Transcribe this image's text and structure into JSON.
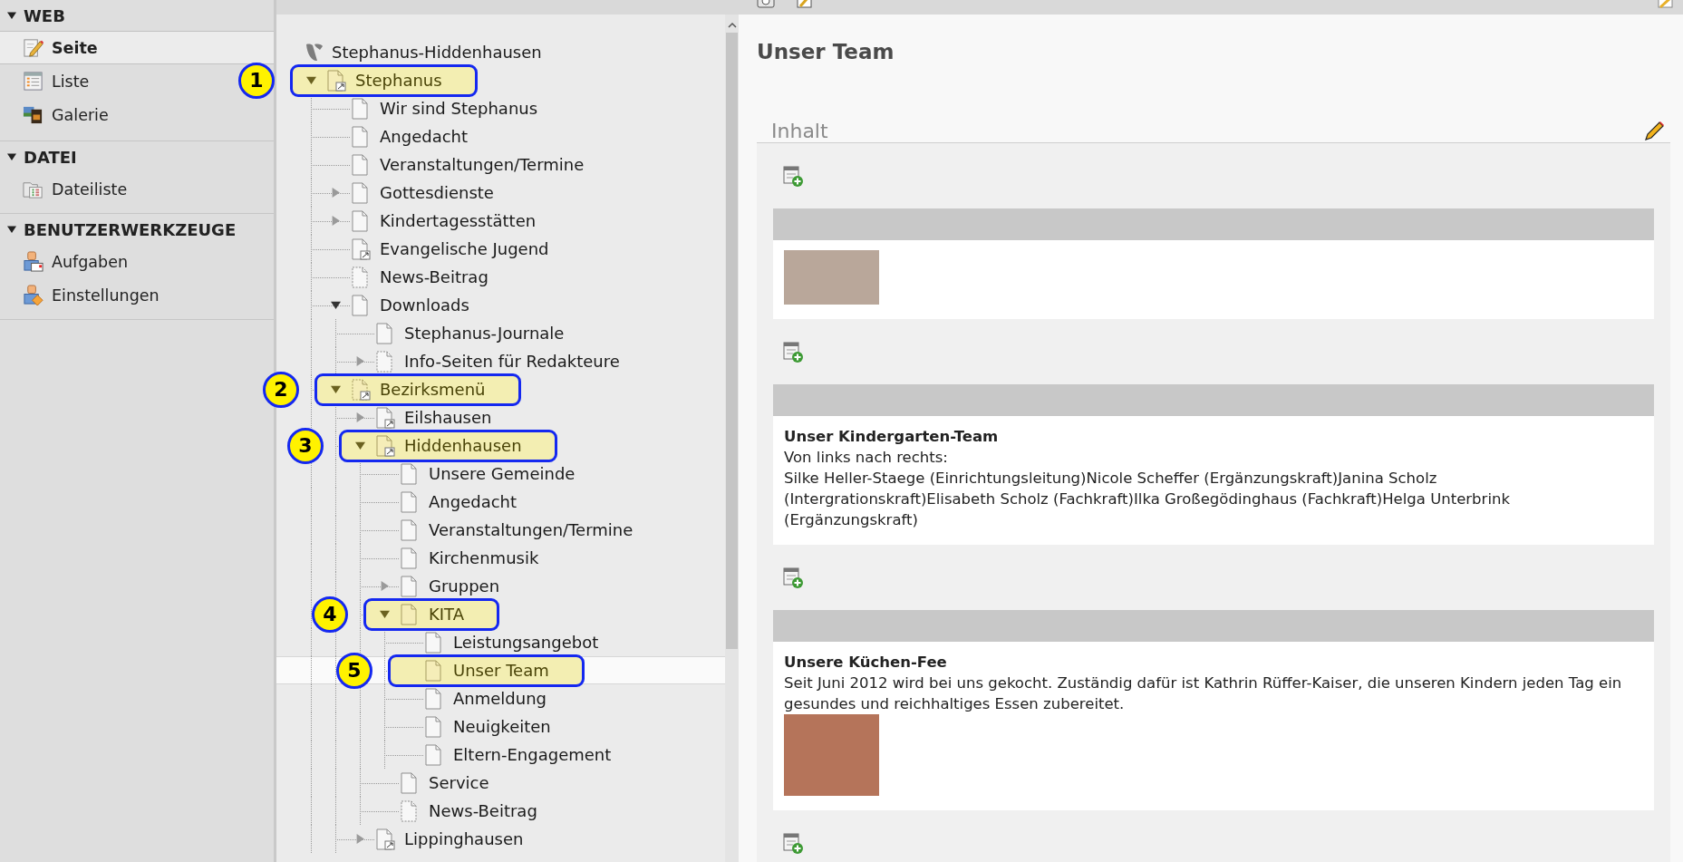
{
  "module_menu": {
    "sections": [
      {
        "title": "WEB",
        "expanded": true,
        "items": [
          {
            "label": "Seite",
            "kind": "page-edit",
            "selected": true
          },
          {
            "label": "Liste",
            "kind": "list",
            "selected": false
          },
          {
            "label": "Galerie",
            "kind": "gallery",
            "selected": false
          }
        ]
      },
      {
        "title": "DATEI",
        "expanded": true,
        "items": [
          {
            "label": "Dateiliste",
            "kind": "filelist",
            "selected": false
          }
        ]
      },
      {
        "title": "BENUTZERWERKZEUGE",
        "expanded": true,
        "items": [
          {
            "label": "Aufgaben",
            "kind": "tasks",
            "selected": false
          },
          {
            "label": "Einstellungen",
            "kind": "settings",
            "selected": false
          }
        ]
      }
    ]
  },
  "page_tree": {
    "root": {
      "label": "Stephanus-Hiddenhausen",
      "kind": "site-root",
      "selected": false,
      "children": [
        {
          "label": "Stephanus",
          "kind": "shortcut",
          "expanded": true,
          "callout": "1",
          "selected": false,
          "children": [
            {
              "label": "Wir sind Stephanus",
              "kind": "page",
              "selected": false
            },
            {
              "label": "Angedacht",
              "kind": "page",
              "selected": false
            },
            {
              "label": "Veranstaltungen/Termine",
              "kind": "page",
              "selected": false
            },
            {
              "label": "Gottesdienste",
              "kind": "page",
              "expanded": false,
              "selected": false
            },
            {
              "label": "Kindertagesstätten",
              "kind": "page",
              "expanded": false,
              "selected": false
            },
            {
              "label": "Evangelische Jugend",
              "kind": "shortcut",
              "selected": false
            },
            {
              "label": "News-Beitrag",
              "kind": "hidden",
              "selected": false
            },
            {
              "label": "Downloads",
              "kind": "page",
              "expanded": true,
              "selected": false,
              "children": [
                {
                  "label": "Stephanus-Journale",
                  "kind": "page",
                  "selected": false
                },
                {
                  "label": "Info-Seiten für Redakteure",
                  "kind": "hidden",
                  "expanded": false,
                  "selected": false
                }
              ]
            },
            {
              "label": "Bezirksmenü",
              "kind": "hidden-shortcut",
              "expanded": true,
              "callout": "2",
              "selected": false,
              "children": [
                {
                  "label": "Eilshausen",
                  "kind": "shortcut",
                  "expanded": false,
                  "selected": false
                },
                {
                  "label": "Hiddenhausen",
                  "kind": "shortcut",
                  "expanded": true,
                  "callout": "3",
                  "selected": false,
                  "children": [
                    {
                      "label": "Unsere Gemeinde",
                      "kind": "page",
                      "selected": false
                    },
                    {
                      "label": "Angedacht",
                      "kind": "page",
                      "selected": false
                    },
                    {
                      "label": "Veranstaltungen/Termine",
                      "kind": "page",
                      "selected": false
                    },
                    {
                      "label": "Kirchenmusik",
                      "kind": "page",
                      "selected": false
                    },
                    {
                      "label": "Gruppen",
                      "kind": "page",
                      "expanded": false,
                      "selected": false
                    },
                    {
                      "label": "KITA",
                      "kind": "page",
                      "expanded": true,
                      "callout": "4",
                      "selected": false,
                      "children": [
                        {
                          "label": "Leistungsangebot",
                          "kind": "page",
                          "selected": false
                        },
                        {
                          "label": "Unser Team",
                          "kind": "page",
                          "callout": "5",
                          "selected": true
                        },
                        {
                          "label": "Anmeldung",
                          "kind": "page",
                          "selected": false
                        },
                        {
                          "label": "Neuigkeiten",
                          "kind": "page",
                          "selected": false
                        },
                        {
                          "label": "Eltern-Engagement",
                          "kind": "page",
                          "selected": false
                        }
                      ]
                    },
                    {
                      "label": "Service",
                      "kind": "page",
                      "selected": false
                    },
                    {
                      "label": "News-Beitrag",
                      "kind": "hidden",
                      "selected": false
                    }
                  ]
                },
                {
                  "label": "Lippinghausen",
                  "kind": "shortcut",
                  "expanded": false,
                  "selected": false
                }
              ]
            }
          ]
        }
      ]
    }
  },
  "page_content": {
    "title": "Unser Team",
    "column": {
      "label": "Inhalt",
      "elements": [
        {
          "kind": "image"
        },
        {
          "kind": "text",
          "header": "Unser Kindergarten-Team",
          "body": "Von links nach rechts:\nSilke Heller-Staege (Einrichtungsleitung)Nicole Scheffer (Ergänzungskraft)Janina Scholz\n(Intergrationskraft)Elisabeth Scholz (Fachkraft)Ilka Großegödinghaus (Fachkraft)Helga Unterbrink\n(Ergänzungskraft)"
        },
        {
          "kind": "textpic",
          "header": "Unsere Küchen-Fee",
          "body": "Seit Juni 2012 wird bei uns gekocht. Zuständig dafür ist Kathrin Rüffer-Kaiser, die unseren Kindern jeden Tag ein gesundes und reichhaltiges Essen zubereitet."
        }
      ]
    }
  }
}
